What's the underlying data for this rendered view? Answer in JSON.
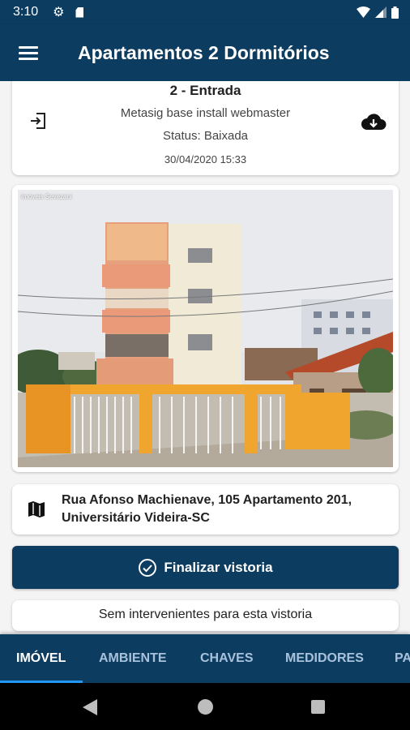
{
  "status_bar": {
    "time": "3:10",
    "icons": [
      "gear-icon",
      "sd-card-icon",
      "wifi-icon",
      "signal-icon",
      "battery-icon"
    ]
  },
  "app_bar": {
    "title": "Apartamentos 2 Dormitórios",
    "menu_icon": "hamburger-menu-icon"
  },
  "entry_card": {
    "title": "2 - Entrada",
    "user": "Metasig base install webmaster",
    "status": "Status: Baixada",
    "date": "30/04/2020 15:33",
    "left_icon": "login-icon",
    "right_icon": "cloud-download-icon"
  },
  "photo": {
    "watermark": "Imóveis Sevezani",
    "description_icon": "building-photo"
  },
  "address": {
    "icon": "map-icon",
    "text": "Rua Afonso Machienave, 105 Apartamento 201, Universitário Videira-SC"
  },
  "finish_button": {
    "label": "Finalizar vistoria",
    "icon": "check-circle-icon"
  },
  "notice": {
    "text": "Sem intervenientes para esta vistoria"
  },
  "tabs": [
    {
      "label": "IMÓVEL",
      "active": true
    },
    {
      "label": "AMBIENTE",
      "active": false
    },
    {
      "label": "CHAVES",
      "active": false
    },
    {
      "label": "MEDIDORES",
      "active": false
    },
    {
      "label": "PA",
      "active": false
    }
  ],
  "colors": {
    "primary": "#0d3c61",
    "tab_indicator": "#2196f3",
    "tab_inactive": "#a8c2dc",
    "background": "#f4f4f4"
  }
}
